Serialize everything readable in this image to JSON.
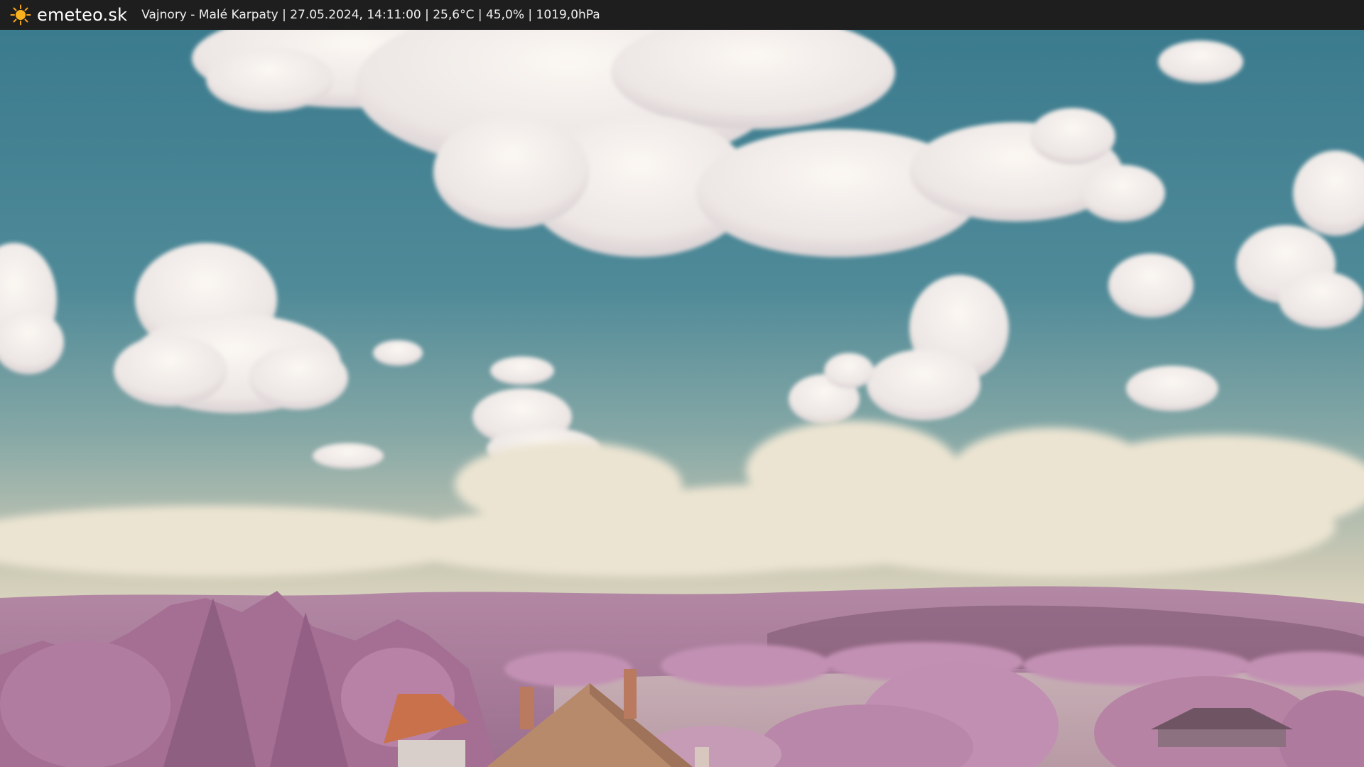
{
  "header": {
    "brand": "emeteo.sk",
    "status": "Vajnory - Malé Karpaty | 27.05.2024, 14:11:00 | 25,6°C | 45,0% | 1019,0hPa",
    "icon": "sun-icon",
    "background": "#1e1e1e"
  },
  "scene": {
    "description_icon": "webcam-image",
    "sky_top": "#3f8093",
    "sky_mid": "#6e9aa3",
    "horizon": "#d8d2bd",
    "hills": "#a97c9c",
    "foliage": "#b98aac",
    "roof": "#c9754e"
  }
}
